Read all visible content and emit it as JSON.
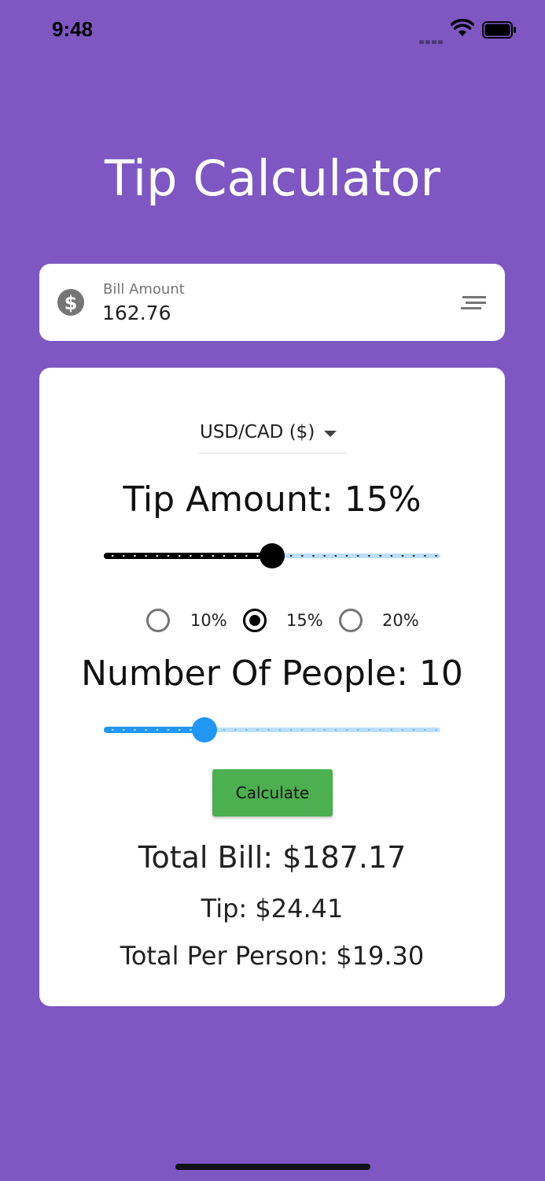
{
  "status_bar": {
    "time": "9:48"
  },
  "app": {
    "title": "Tip Calculator"
  },
  "bill": {
    "label": "Bill Amount",
    "value": "162.76"
  },
  "currency": {
    "selected": "USD/CAD ($)"
  },
  "tip": {
    "heading": "Tip Amount: 15%",
    "slider_fraction": 0.5,
    "options": [
      "10%",
      "15%",
      "20%"
    ],
    "selected_option": "15%"
  },
  "people": {
    "heading": "Number Of People: 10",
    "slider_fraction": 0.3
  },
  "actions": {
    "calculate_label": "Calculate"
  },
  "results": {
    "total_bill": "Total Bill: $187.17",
    "tip": "Tip: $24.41",
    "per_person": "Total Per Person: $19.30"
  },
  "colors": {
    "background": "#7e57c2",
    "accent": "#2196f3",
    "button": "#4caf50"
  }
}
